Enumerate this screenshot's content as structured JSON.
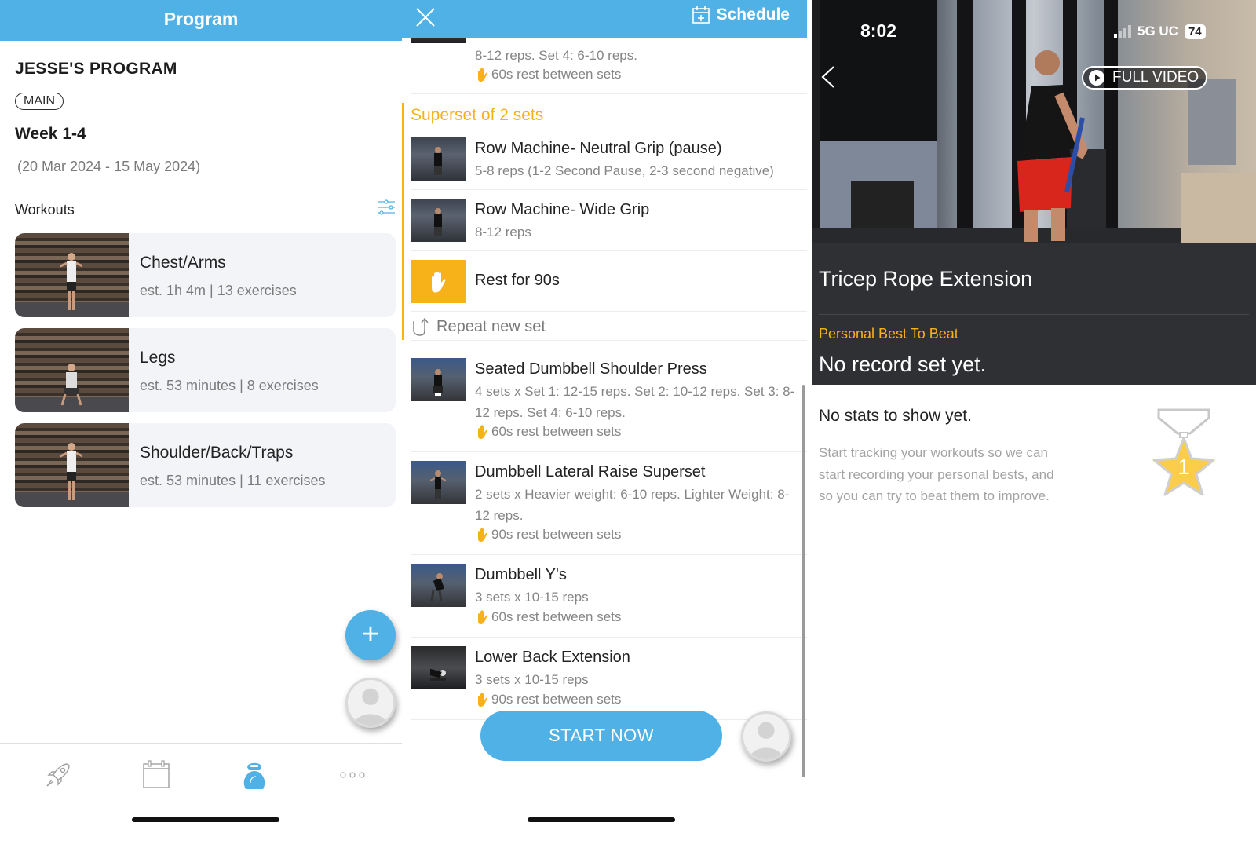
{
  "panel1": {
    "header_title": "Program",
    "program_name": "JESSE'S PROGRAM",
    "badge": "MAIN",
    "week": "Week 1-4",
    "dates": "(20 Mar 2024 - 15 May 2024)",
    "workouts_label": "Workouts",
    "workouts": [
      {
        "name": "Chest/Arms",
        "meta": "est. 1h 4m | 13 exercises"
      },
      {
        "name": "Legs",
        "meta": "est. 53 minutes | 8 exercises"
      },
      {
        "name": "Shoulder/Back/Traps",
        "meta": "est. 53 minutes | 11 exercises"
      }
    ],
    "fab_add": "+",
    "tabs": [
      "rocket-icon",
      "calendar-icon",
      "kettlebell-icon",
      "more-icon"
    ],
    "active_tab": "kettlebell-icon"
  },
  "panel2": {
    "schedule_label": "Schedule",
    "top_partial": {
      "detail": "8-12 reps. Set 4: 6-10 reps.",
      "rest": "60s rest between sets"
    },
    "superset_title": "Superset of 2 sets",
    "superset_items": [
      {
        "name": "Row Machine- Neutral Grip (pause)",
        "detail": "5-8 reps (1-2 Second Pause, 2-3 second negative)"
      },
      {
        "name": "Row Machine- Wide Grip",
        "detail": "8-12 reps"
      }
    ],
    "rest_label": "Rest for 90s",
    "repeat_label": "Repeat new set",
    "exercises": [
      {
        "name": "Seated Dumbbell  Shoulder Press",
        "detail": "4 sets x Set 1: 12-15 reps. Set 2: 10-12 reps. Set 3: 8-12 reps. Set 4: 6-10 reps.",
        "rest": "60s rest between sets"
      },
      {
        "name": "Dumbbell Lateral Raise Superset",
        "detail": "2 sets x Heavier weight: 6-10 reps. Lighter Weight: 8-12 reps.",
        "rest": "90s rest between sets"
      },
      {
        "name": "Dumbbell Y's",
        "detail": "3 sets x 10-15 reps",
        "rest": "60s rest between sets"
      },
      {
        "name": "Lower Back Extension",
        "detail": "3 sets x 10-15 reps",
        "rest": "90s rest between sets"
      }
    ],
    "start_button": "START NOW"
  },
  "panel3": {
    "status_time": "8:02",
    "status_network": "5G UC",
    "status_battery": "74",
    "full_video_label": "FULL VIDEO",
    "exercise_title": "Tricep Rope Extension",
    "pb_label": "Personal Best To Beat",
    "pb_value": "No record set yet.",
    "stats_title": "No stats to show yet.",
    "stats_desc": "Start tracking your workouts so we can start recording your personal bests, and so you can try to beat them to improve.",
    "medal_number": "1"
  },
  "colors": {
    "brand_blue": "#4fb1e6",
    "accent_orange": "#f7b21a",
    "dark_panel": "#2f3033"
  }
}
